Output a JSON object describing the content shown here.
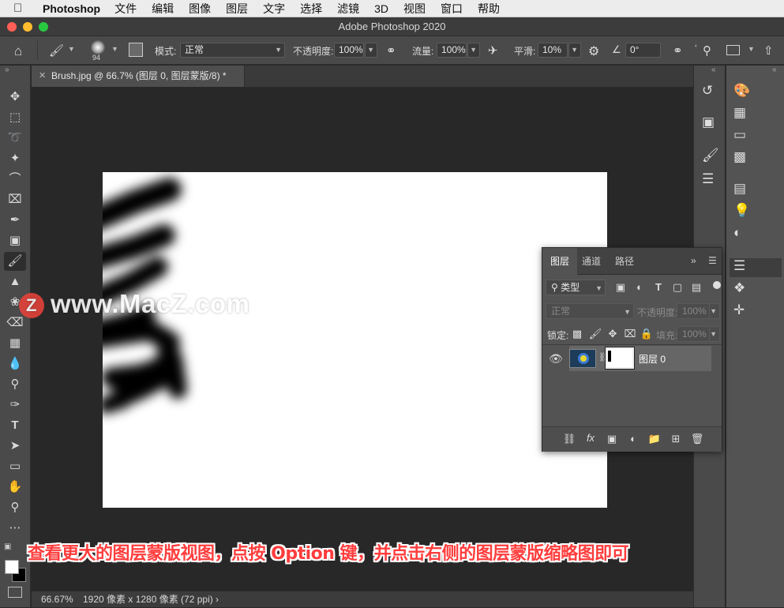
{
  "menubar": {
    "app_name": "Photoshop",
    "items": [
      "文件",
      "编辑",
      "图像",
      "图层",
      "文字",
      "选择",
      "滤镜",
      "3D",
      "视图",
      "窗口",
      "帮助"
    ]
  },
  "window": {
    "title": "Adobe Photoshop 2020"
  },
  "options_bar": {
    "brush_size": "94",
    "mode_label": "模式:",
    "mode_value": "正常",
    "opacity_label": "不透明度:",
    "opacity_value": "100%",
    "flow_label": "流量:",
    "flow_value": "100%",
    "smoothing_label": "平滑:",
    "smoothing_value": "10%",
    "angle_value": "0°"
  },
  "document": {
    "tab_title": "Brush.jpg @ 66.7% (图层 0, 图层蒙版/8) *"
  },
  "layers_panel": {
    "tabs": [
      "图层",
      "通道",
      "路径"
    ],
    "filter_kind": "类型",
    "blend_mode": "正常",
    "opacity_label": "不透明度:",
    "opacity_value": "100%",
    "lock_label": "锁定:",
    "fill_label": "填充:",
    "fill_value": "100%",
    "layer_name": "图层 0"
  },
  "status_bar": {
    "zoom": "66.67%",
    "doc_info": "1920 像素 x 1280 像素 (72 ppi)"
  },
  "overlay": {
    "watermark": "www.MacZ.com",
    "watermark_logo": "Z",
    "caption": "查看更大的图层蒙版视图，点按 Option 键，并点击右侧的图层蒙版缩略图即可"
  },
  "colors": {
    "accent_red": "#e8433a",
    "caption_red": "#ff3d3d"
  }
}
